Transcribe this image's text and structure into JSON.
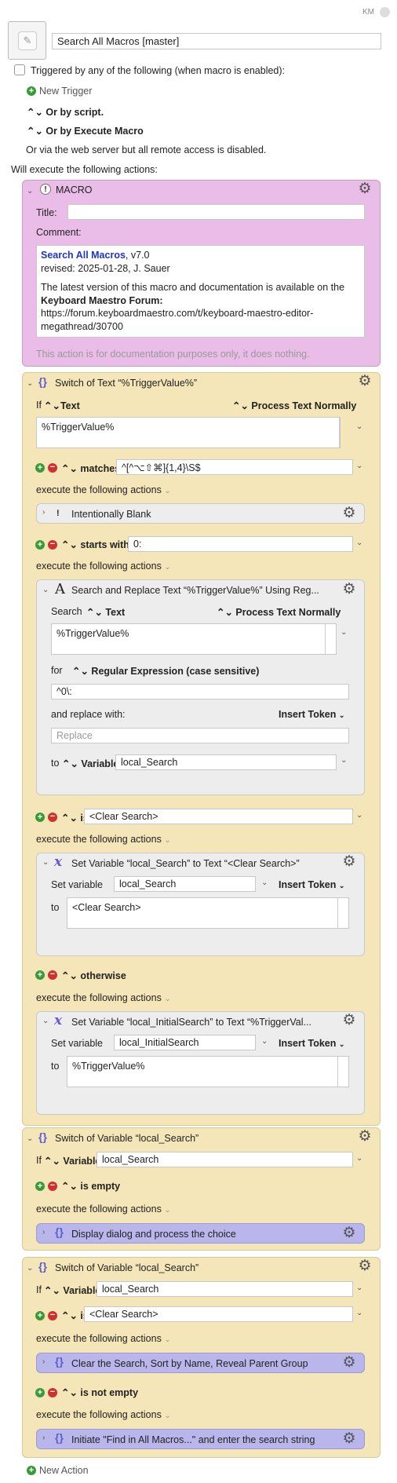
{
  "top": {
    "km_badge": "KM"
  },
  "macro": {
    "name": "Search All Macros [master]"
  },
  "triggers": {
    "checkbox_label": "Triggered by any of the following (when macro is enabled):",
    "new_trigger": "New Trigger",
    "or_by_script": "Or by script.",
    "or_by_execute": "Or by Execute Macro",
    "web_server": "Or via the web server but all remote access is disabled."
  },
  "will_execute": "Will execute the following actions:",
  "comment_action": {
    "title": "MACRO",
    "title_label": "Title:",
    "comment_label": "Comment:",
    "comment_title": "Search All Macros",
    "comment_version": ", v7.0",
    "comment_revised": "revised: 2025-01-28, J. Sauer",
    "comment_p1": "The latest version of this macro and documentation is available on the",
    "comment_forum": "Keyboard Maestro Forum:",
    "comment_url1": "https://forum.keyboardmaestro.com/t/keyboard-maestro-editor-",
    "comment_url2": "megathread/30700",
    "note": "This action is for documentation purposes only, it does nothing."
  },
  "switch1": {
    "title": "Switch of Text “%TriggerValue%”",
    "if_label": "If",
    "source": "Text",
    "process": "Process Text Normally",
    "text_value": "%TriggerValue%",
    "case1_op": "matches",
    "case1_value": "^[^⌥⇧⌘]{1,4}\\S$",
    "execute": "execute the following actions",
    "blank_title": "Intentionally Blank",
    "case2_op": "starts with",
    "case2_value": "0:",
    "sr_title": "Search and Replace Text “%TriggerValue%” Using Reg...",
    "sr_search": "Search",
    "sr_source": "Text",
    "sr_process": "Process Text Normally",
    "sr_text": "%TriggerValue%",
    "sr_for": "for",
    "sr_mode": "Regular Expression (case sensitive)",
    "sr_pattern": "^0\\:",
    "sr_replace_label": "and replace with:",
    "sr_insert": "Insert Token",
    "sr_replace_ph": "Replace",
    "sr_to": "to",
    "sr_to_kind": "Variable",
    "sr_to_var": "local_Search",
    "case3_op": "is",
    "case3_value": "<Clear Search>",
    "sv1_title": "Set Variable “local_Search” to Text “<Clear Search>”",
    "sv1_label": "Set variable",
    "sv1_var": "local_Search",
    "sv1_insert": "Insert Token",
    "sv1_to": "to",
    "sv1_value": "<Clear Search>",
    "case4_op": "otherwise",
    "sv2_title": "Set Variable “local_InitialSearch” to Text “%TriggerVal...",
    "sv2_label": "Set variable",
    "sv2_var": "local_InitialSearch",
    "sv2_insert": "Insert Token",
    "sv2_to": "to",
    "sv2_value": "%TriggerValue%"
  },
  "switch2": {
    "title": "Switch of Variable “local_Search”",
    "if_label": "If",
    "source": "Variable",
    "var": "local_Search",
    "case_op": "is empty",
    "execute": "execute the following actions",
    "group": "Display dialog and process the choice"
  },
  "switch3": {
    "title": "Switch of Variable “local_Search”",
    "if_label": "If",
    "source": "Variable",
    "var": "local_Search",
    "case1_op": "is",
    "case1_value": "<Clear Search>",
    "execute": "execute the following actions",
    "group1": "Clear the Search, Sort by Name, Reveal Parent Group",
    "case2_op": "is not empty",
    "group2": "Initiate \"Find in All Macros...\" and enter the search string"
  },
  "new_action": "New Action"
}
